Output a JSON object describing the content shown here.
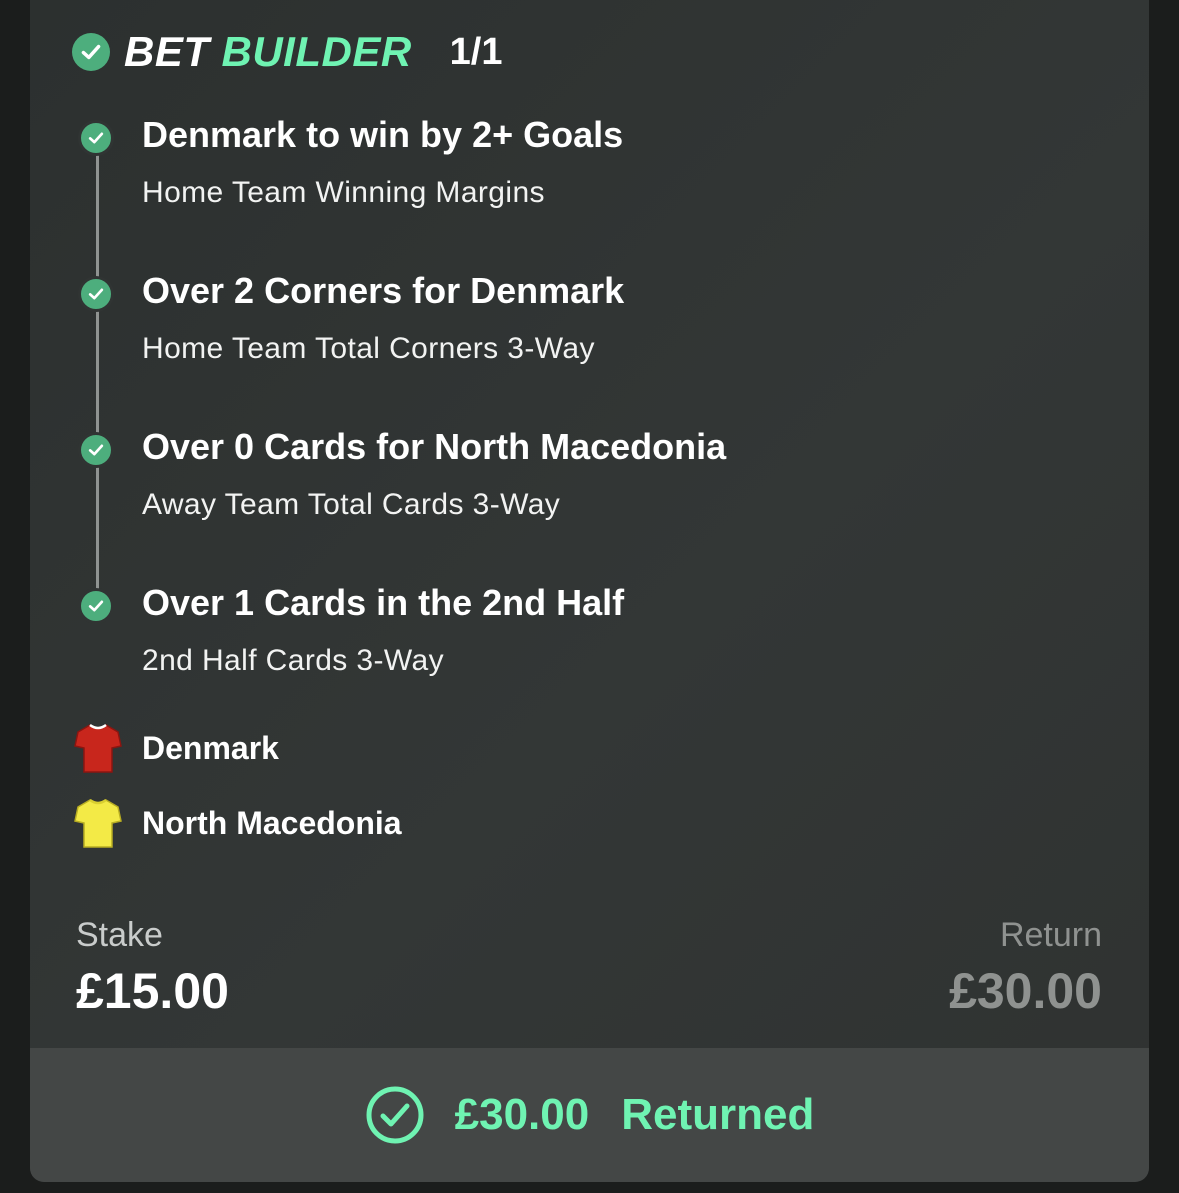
{
  "header": {
    "title_part1": "BET",
    "title_part2": "BUILDER",
    "count": "1/1"
  },
  "legs": [
    {
      "selection": "Denmark to win by 2+ Goals",
      "market": "Home Team Winning Margins",
      "status": "won"
    },
    {
      "selection": "Over 2 Corners for Denmark",
      "market": "Home Team Total Corners 3-Way",
      "status": "won"
    },
    {
      "selection": "Over 0 Cards for North Macedonia",
      "market": "Away Team Total Cards 3-Way",
      "status": "won"
    },
    {
      "selection": "Over 1 Cards in the 2nd Half",
      "market": "2nd Half Cards 3-Way",
      "status": "won"
    }
  ],
  "teams": [
    {
      "name": "Denmark",
      "shirt_color": "#c8261c",
      "icon": "shirt-icon"
    },
    {
      "name": "North Macedonia",
      "shirt_color": "#f3ea46",
      "icon": "shirt-icon"
    }
  ],
  "stake": {
    "label": "Stake",
    "value": "£15.00"
  },
  "return": {
    "label": "Return",
    "value": "£30.00"
  },
  "footer": {
    "amount": "£30.00",
    "status": "Returned",
    "icon": "check-circle-icon"
  },
  "colors": {
    "accent": "#6ff3b2",
    "check_green": "#4dae7d",
    "card_bg": "#303433",
    "footer_bg": "#444746"
  }
}
